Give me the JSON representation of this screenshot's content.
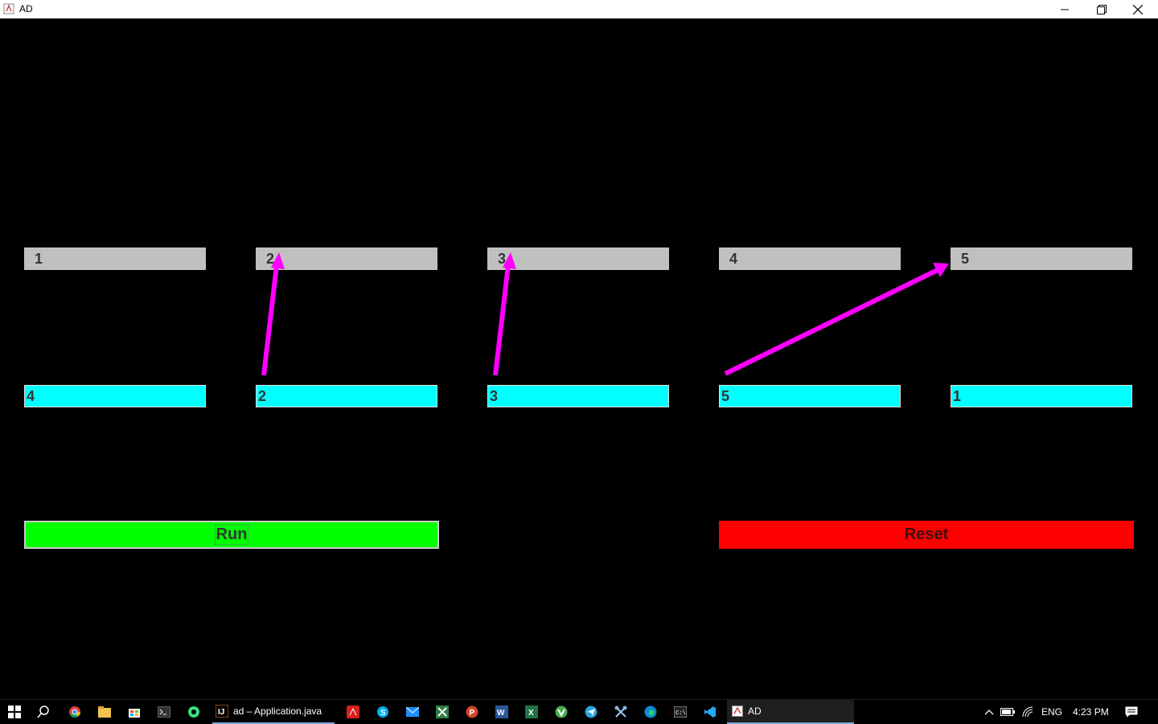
{
  "window": {
    "title": "AD"
  },
  "top_boxes": [
    {
      "label": "1"
    },
    {
      "label": "2"
    },
    {
      "label": "3"
    },
    {
      "label": "4"
    },
    {
      "label": "5"
    }
  ],
  "bottom_boxes": [
    {
      "label": "4"
    },
    {
      "label": "2"
    },
    {
      "label": "3"
    },
    {
      "label": "5"
    },
    {
      "label": "1"
    }
  ],
  "buttons": {
    "run": "Run",
    "reset": "Reset"
  },
  "colors": {
    "background": "#000000",
    "top_box": "#c0c0c0",
    "bottom_box": "#00ffff",
    "arrow": "#ff00ff",
    "run": "#00ff00",
    "reset": "#ff0000"
  },
  "taskbar": {
    "active_task_ide": "ad – Application.java",
    "active_task_app": "AD",
    "language": "ENG",
    "time": "4:23 PM"
  }
}
